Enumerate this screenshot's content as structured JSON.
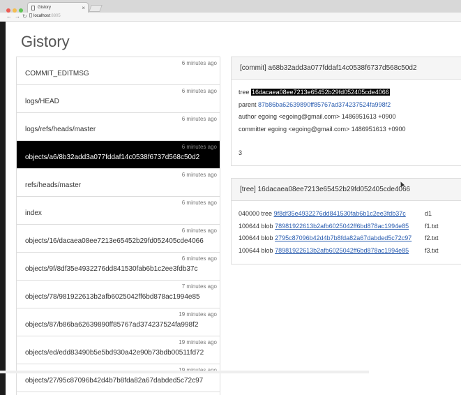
{
  "browser": {
    "tab_title": "Gistory",
    "tab_close": "×",
    "address_host": "localhost",
    "address_port": ":8805",
    "back": "←",
    "forward": "→",
    "reload": "↻"
  },
  "colors": {
    "accent_link": "#2a5db0",
    "highlight_bg": "#000000",
    "active_row_bg": "#000000"
  },
  "page": {
    "title": "Gistory"
  },
  "files": [
    {
      "time": "6 minutes ago",
      "name": "COMMIT_EDITMSG"
    },
    {
      "time": "6 minutes ago",
      "name": "logs/HEAD"
    },
    {
      "time": "6 minutes ago",
      "name": "logs/refs/heads/master"
    },
    {
      "time": "6 minutes ago",
      "name": "objects/a6/8b32add3a077fddaf14c0538f6737d568c50d2",
      "active": true
    },
    {
      "time": "6 minutes ago",
      "name": "refs/heads/master"
    },
    {
      "time": "6 minutes ago",
      "name": "index"
    },
    {
      "time": "6 minutes ago",
      "name": "objects/16/dacaea08ee7213e65452b29fd052405cde4066"
    },
    {
      "time": "6 minutes ago",
      "name": "objects/9f/8df35e4932276dd841530fab6b1c2ee3fdb37c"
    },
    {
      "time": "7 minutes ago",
      "name": "objects/78/981922613b2afb6025042ff6bd878ac1994e85"
    },
    {
      "time": "19 minutes ago",
      "name": "objects/87/b86ba62639890ff85767ad374237524fa998f2"
    },
    {
      "time": "19 minutes ago",
      "name": "objects/ed/edd83490b5e5bd930a42e90b73bdb00511fd72"
    },
    {
      "time": "19 minutes ago",
      "name": "objects/27/95c87096b42d4b7b8fda82a67dabded5c72c97"
    }
  ],
  "commit": {
    "heading": "[commit] a68b32add3a077fddaf14c0538f6737d568c50d2",
    "tree_label": "tree",
    "tree_hash": "16dacaea08ee7213e65452b29fd052405cde4066",
    "parent_label": "parent",
    "parent_hash": "87b86ba62639890ff85767ad374237524fa998f2",
    "author": "author egoing <egoing@gmail.com> 1486951613 +0900",
    "committer": "committer egoing <egoing@gmail.com> 1486951613 +0900",
    "message": "3"
  },
  "tree": {
    "heading": "[tree] 16dacaea08ee7213e65452b29fd052405cde4066",
    "entries": [
      {
        "mode": "040000 tree",
        "hash": "9f8df35e4932276dd841530fab6b1c2ee3fdb37c",
        "name": "d1"
      },
      {
        "mode": "100644 blob",
        "hash": "78981922613b2afb6025042ff6bd878ac1994e85",
        "name": "f1.txt"
      },
      {
        "mode": "100644 blob",
        "hash": "2795c87096b42d4b7b8fda82a67dabded5c72c97",
        "name": "f2.txt"
      },
      {
        "mode": "100644 blob",
        "hash": "78981922613b2afb6025042ff6bd878ac1994e85",
        "name": "f3.txt"
      }
    ]
  },
  "video": {
    "progress_percent": 80
  }
}
